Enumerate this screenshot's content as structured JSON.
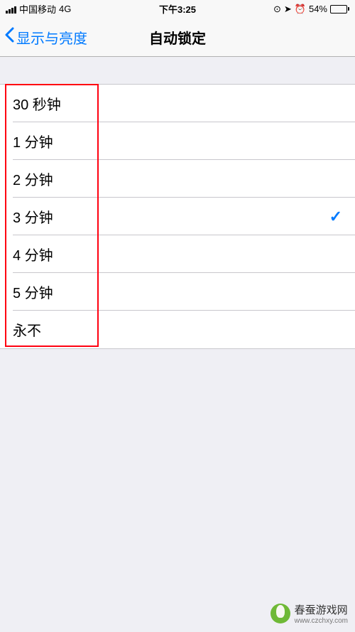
{
  "statusBar": {
    "carrier": "中国移动",
    "network": "4G",
    "time": "下午3:25",
    "batteryPercent": "54%"
  },
  "nav": {
    "backLabel": "显示与亮度",
    "title": "自动锁定"
  },
  "options": [
    {
      "label": "30 秒钟",
      "selected": false
    },
    {
      "label": "1 分钟",
      "selected": false
    },
    {
      "label": "2 分钟",
      "selected": false
    },
    {
      "label": "3 分钟",
      "selected": true
    },
    {
      "label": "4 分钟",
      "selected": false
    },
    {
      "label": "5 分钟",
      "selected": false
    },
    {
      "label": "永不",
      "selected": false
    }
  ],
  "watermark": {
    "text": "春蚕游戏网",
    "url": "www.czchxy.com"
  }
}
